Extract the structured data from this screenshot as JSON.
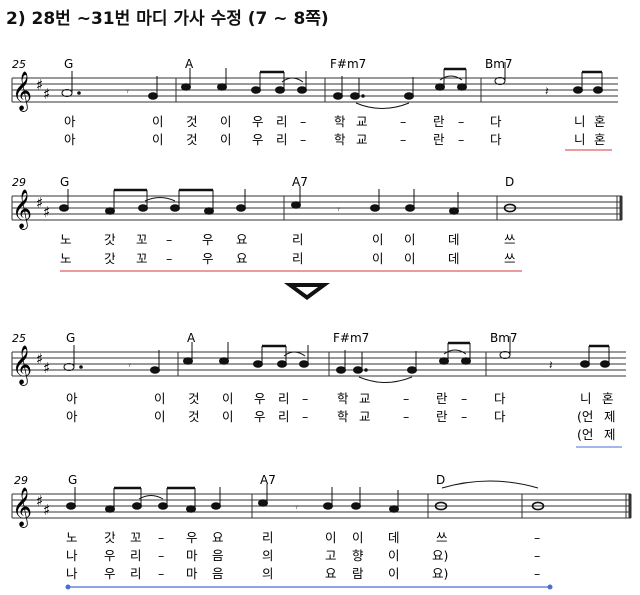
{
  "heading": "2) 28번 ~31번 마디 가사 수정 (7 ~ 8쪽)",
  "arrow": "down-triangle-icon",
  "colors": {
    "underline_red": "#d9343c",
    "underline_blue": "#4a6ed8",
    "staff": "#333333"
  },
  "systems": [
    {
      "id": "before-line1",
      "measure_number": "25",
      "chords": [
        "G",
        "A",
        "F#m7",
        "Bm7"
      ],
      "lyrics": [
        [
          "아",
          "이",
          "것",
          "이",
          "우",
          "리",
          "–",
          "학",
          "교",
          "–",
          "란",
          "–",
          "다",
          "니",
          "혼"
        ],
        [
          "아",
          "이",
          "것",
          "이",
          "우",
          "리",
          "–",
          "학",
          "교",
          "–",
          "란",
          "–",
          "다",
          "니",
          "혼"
        ]
      ]
    },
    {
      "id": "before-line2",
      "measure_number": "29",
      "chords": [
        "G",
        "A7",
        "D"
      ],
      "lyrics": [
        [
          "노",
          "갓",
          "꼬",
          "–",
          "우",
          "요",
          "리",
          "이",
          "이",
          "데",
          "쓰"
        ],
        [
          "노",
          "갓",
          "꼬",
          "–",
          "우",
          "요",
          "리",
          "이",
          "이",
          "데",
          "쓰"
        ]
      ]
    },
    {
      "id": "after-line1",
      "measure_number": "25",
      "chords": [
        "G",
        "A",
        "F#m7",
        "Bm7"
      ],
      "lyrics": [
        [
          "아",
          "이",
          "것",
          "이",
          "우",
          "리",
          "–",
          "학",
          "교",
          "–",
          "란",
          "–",
          "다",
          "니",
          "혼"
        ],
        [
          "아",
          "이",
          "것",
          "이",
          "우",
          "리",
          "–",
          "학",
          "교",
          "–",
          "란",
          "–",
          "다",
          "(언",
          "제"
        ],
        [
          "(언",
          "제"
        ]
      ]
    },
    {
      "id": "after-line2",
      "measure_number": "29",
      "chords": [
        "G",
        "A7",
        "D"
      ],
      "lyrics": [
        [
          "노",
          "갓",
          "꼬",
          "–",
          "우",
          "요",
          "리",
          "이",
          "이",
          "데",
          "쓰",
          "–"
        ],
        [
          "나",
          "우",
          "리",
          "–",
          "마",
          "음",
          "의",
          "고",
          "향",
          "이",
          "요)",
          "–"
        ],
        [
          "나",
          "우",
          "리",
          "–",
          "마",
          "음",
          "의",
          "요",
          "람",
          "이",
          "요)",
          "–"
        ]
      ]
    }
  ]
}
